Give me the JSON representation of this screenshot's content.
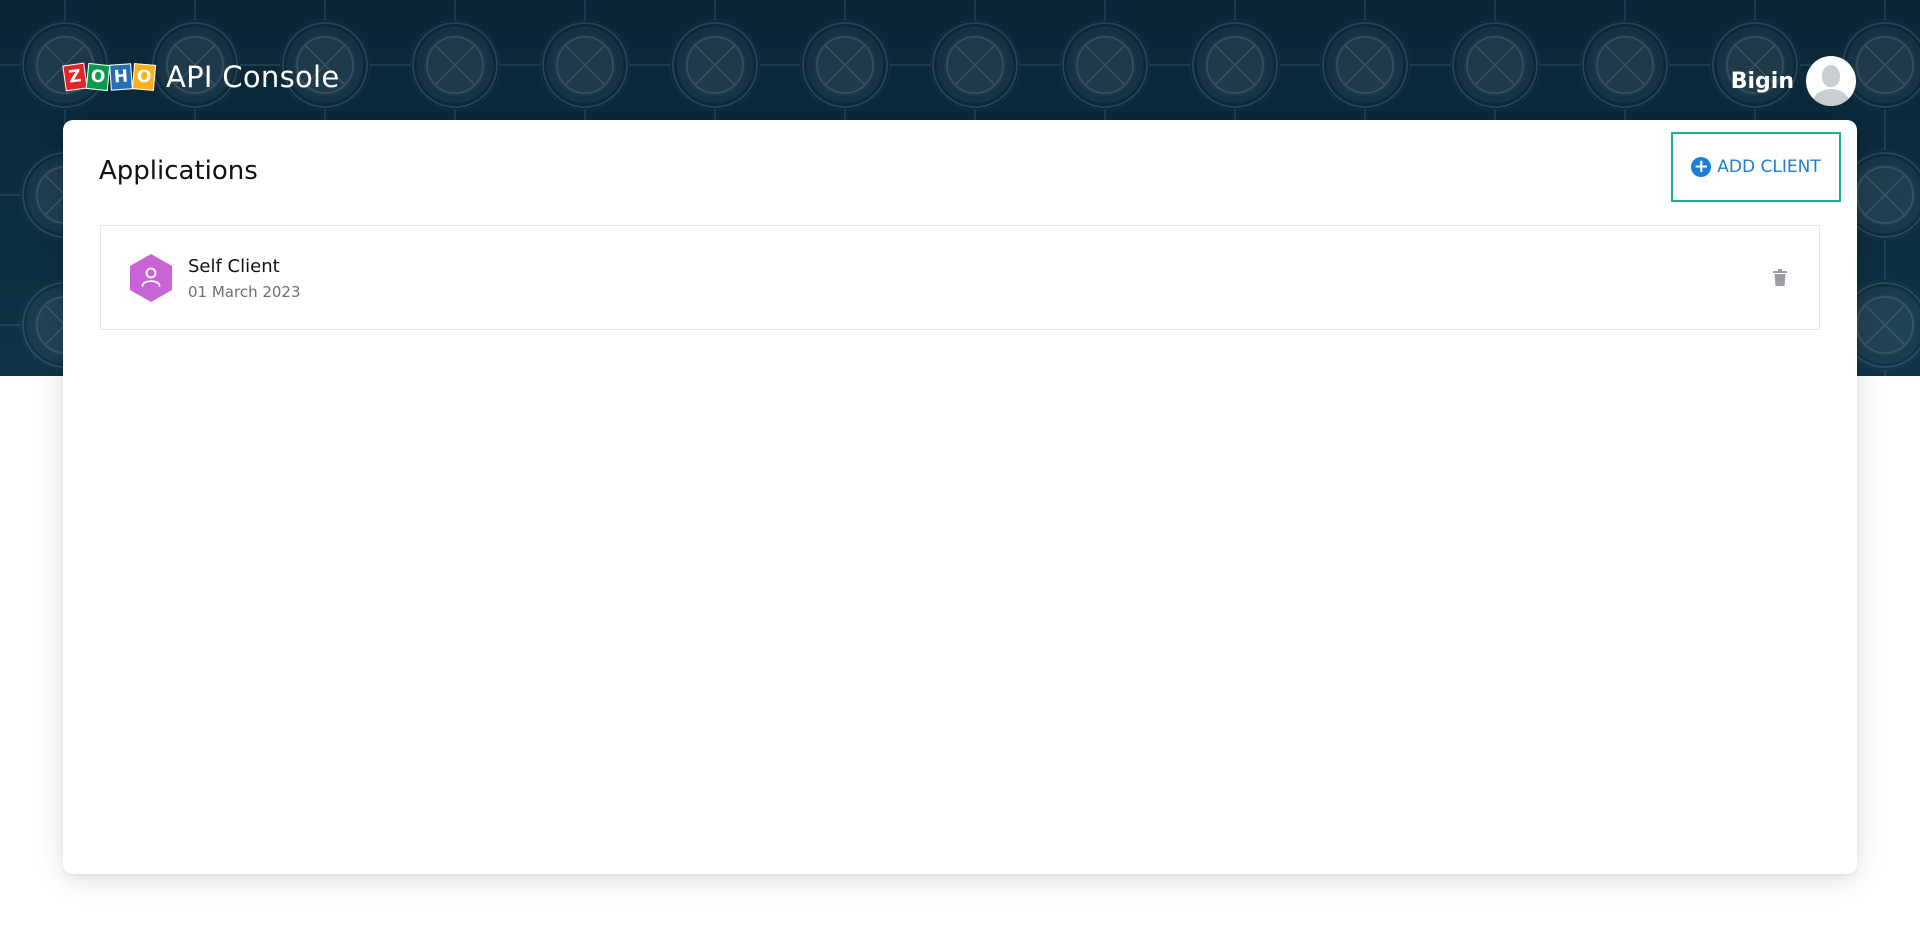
{
  "header": {
    "logo_letters": [
      "Z",
      "O",
      "H",
      "O"
    ],
    "app_title": "API Console",
    "user_name": "Bigin"
  },
  "main": {
    "title": "Applications",
    "add_client_label": "ADD CLIENT",
    "clients": [
      {
        "name": "Self Client",
        "date": "01 March 2023",
        "icon": "user-hexagon-icon"
      }
    ]
  },
  "colors": {
    "header_bg": "#0b2a3d",
    "accent_blue": "#1a7fd8",
    "focus_outline": "#1fae93",
    "client_icon": "#c964d6"
  }
}
